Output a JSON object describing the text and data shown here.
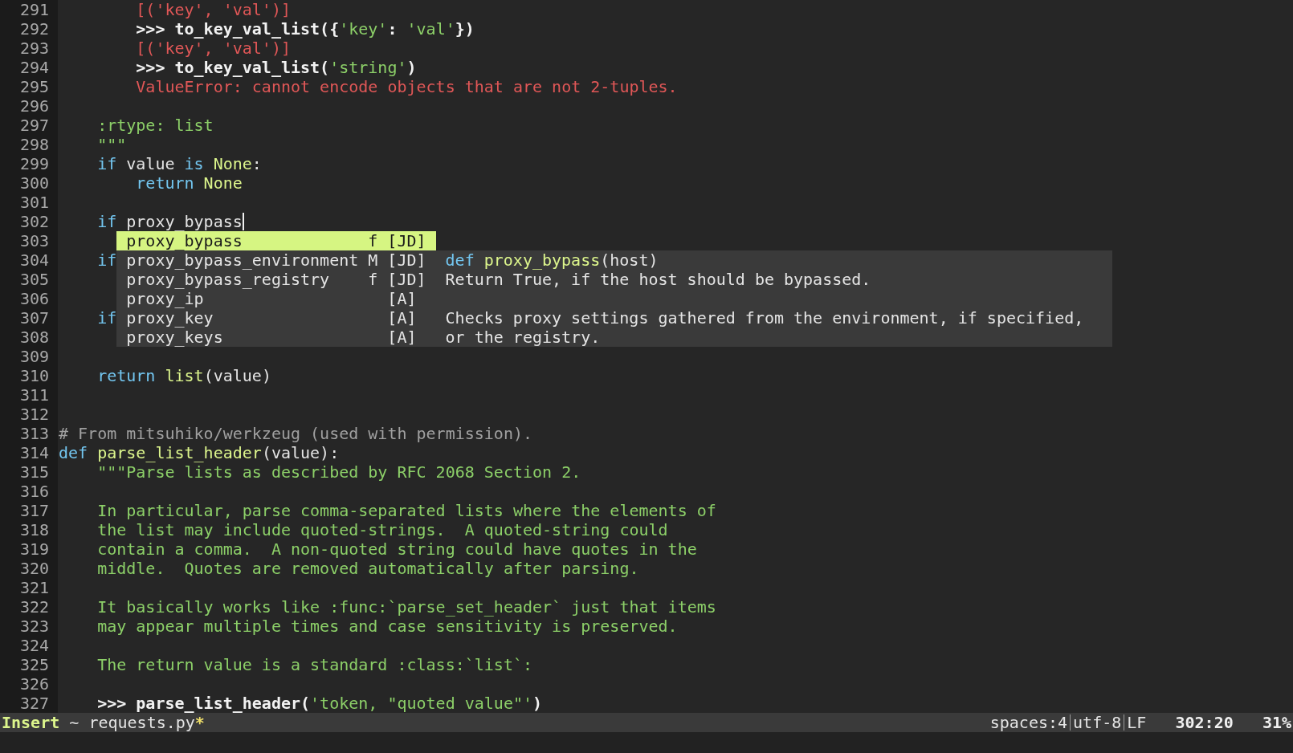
{
  "editor": {
    "lines": [
      {
        "number": "291",
        "cursor": false,
        "tokens": [
          {
            "t": "        [('key', 'val')]",
            "kind": "err"
          }
        ]
      },
      {
        "number": "292",
        "cursor": false,
        "tokens": [
          {
            "t": "        >>> to_key_val_list({",
            "kind": "bold"
          },
          {
            "t": "'key'",
            "kind": "str"
          },
          {
            "t": ": ",
            "kind": "bold"
          },
          {
            "t": "'val'",
            "kind": "str"
          },
          {
            "t": "})",
            "kind": "bold"
          }
        ]
      },
      {
        "number": "293",
        "cursor": false,
        "tokens": [
          {
            "t": "        [('key', 'val')]",
            "kind": "err"
          }
        ]
      },
      {
        "number": "294",
        "cursor": false,
        "tokens": [
          {
            "t": "        >>> to_key_val_list(",
            "kind": "bold"
          },
          {
            "t": "'string'",
            "kind": "str"
          },
          {
            "t": ")",
            "kind": "bold"
          }
        ]
      },
      {
        "number": "295",
        "cursor": false,
        "tokens": [
          {
            "t": "        ValueError: cannot encode objects that are not 2-tuples.",
            "kind": "err"
          }
        ]
      },
      {
        "number": "296",
        "cursor": false
      },
      {
        "number": "297",
        "cursor": false,
        "tokens": [
          {
            "t": "    :rtype: list",
            "kind": "doc"
          }
        ]
      },
      {
        "number": "298",
        "cursor": false,
        "tokens": [
          {
            "t": "    \"\"\"",
            "kind": "doc"
          }
        ]
      },
      {
        "number": "299",
        "cursor": false,
        "tokens": [
          {
            "t": "    if",
            "kind": "kw"
          },
          {
            "t": " value ",
            "kind": "plain"
          },
          {
            "t": "is",
            "kind": "kw"
          },
          {
            "t": " None",
            "kind": "const"
          },
          {
            "t": ":",
            "kind": "plain"
          }
        ]
      },
      {
        "number": "300",
        "cursor": false,
        "tokens": [
          {
            "t": "        return",
            "kind": "kw"
          },
          {
            "t": " None",
            "kind": "const"
          }
        ]
      },
      {
        "number": "301",
        "cursor": false
      },
      {
        "number": "302",
        "cursor": true,
        "tokens": [
          {
            "t": "    if",
            "kind": "kw"
          },
          {
            "t": " proxy_bypass",
            "kind": "plain"
          }
        ]
      },
      {
        "number": "303",
        "cursor": false
      },
      {
        "number": "304",
        "cursor": false,
        "tokens": [
          {
            "t": "    if",
            "kind": "kw"
          }
        ]
      },
      {
        "number": "305",
        "cursor": false
      },
      {
        "number": "306",
        "cursor": false
      },
      {
        "number": "307",
        "cursor": false,
        "tokens": [
          {
            "t": "    if",
            "kind": "kw"
          }
        ]
      },
      {
        "number": "308",
        "cursor": false
      },
      {
        "number": "309",
        "cursor": false
      },
      {
        "number": "310",
        "cursor": false,
        "tokens": [
          {
            "t": "    return",
            "kind": "kw"
          },
          {
            "t": " list",
            "kind": "const"
          },
          {
            "t": "(value)",
            "kind": "plain"
          }
        ]
      },
      {
        "number": "311",
        "cursor": false
      },
      {
        "number": "312",
        "cursor": false
      },
      {
        "number": "313",
        "cursor": false,
        "tokens": [
          {
            "t": "# From mitsuhiko/werkzeug (used with permission).",
            "kind": "comment"
          }
        ]
      },
      {
        "number": "314",
        "cursor": false,
        "tokens": [
          {
            "t": "def ",
            "kind": "kw"
          },
          {
            "t": "parse_list_header",
            "kind": "const"
          },
          {
            "t": "(value):",
            "kind": "plain"
          }
        ]
      },
      {
        "number": "315",
        "cursor": false,
        "tokens": [
          {
            "t": "    \"\"\"Parse lists as described by RFC 2068 Section 2.",
            "kind": "doc"
          }
        ]
      },
      {
        "number": "316",
        "cursor": false
      },
      {
        "number": "317",
        "cursor": false,
        "tokens": [
          {
            "t": "    In particular, parse comma-separated lists where the elements of",
            "kind": "doc"
          }
        ]
      },
      {
        "number": "318",
        "cursor": false,
        "tokens": [
          {
            "t": "    the list may include quoted-strings.  A quoted-string could",
            "kind": "doc"
          }
        ]
      },
      {
        "number": "319",
        "cursor": false,
        "tokens": [
          {
            "t": "    contain a comma.  A non-quoted string could have quotes in the",
            "kind": "doc"
          }
        ]
      },
      {
        "number": "320",
        "cursor": false,
        "tokens": [
          {
            "t": "    middle.  Quotes are removed automatically after parsing.",
            "kind": "doc"
          }
        ]
      },
      {
        "number": "321",
        "cursor": false
      },
      {
        "number": "322",
        "cursor": false,
        "tokens": [
          {
            "t": "    It basically works like :func:`parse_set_header` just that items",
            "kind": "doc"
          }
        ]
      },
      {
        "number": "323",
        "cursor": false,
        "tokens": [
          {
            "t": "    may appear multiple times and case sensitivity is preserved.",
            "kind": "doc"
          }
        ]
      },
      {
        "number": "324",
        "cursor": false
      },
      {
        "number": "325",
        "cursor": false,
        "tokens": [
          {
            "t": "    The return value is a standard :class:`list`:",
            "kind": "doc"
          }
        ]
      },
      {
        "number": "326",
        "cursor": false
      },
      {
        "number": "327",
        "cursor": false,
        "tokens": [
          {
            "t": "    >>> parse_list_header(",
            "kind": "bold"
          },
          {
            "t": "'token, \"quoted value\"'",
            "kind": "str"
          },
          {
            "t": ")",
            "kind": "bold"
          }
        ]
      }
    ]
  },
  "completion": {
    "items": [
      {
        "label": "proxy_bypass",
        "type": "f",
        "source": "[JD]",
        "selected": true
      },
      {
        "label": "proxy_bypass_environment",
        "type": "M",
        "source": "[JD]",
        "selected": false
      },
      {
        "label": "proxy_bypass_registry",
        "type": "f",
        "source": "[JD]",
        "selected": false
      },
      {
        "label": "proxy_ip",
        "source": "[A]",
        "selected": false
      },
      {
        "label": "proxy_key",
        "source": "[A]",
        "selected": false
      },
      {
        "label": "proxy_keys",
        "source": "[A]",
        "selected": false
      }
    ],
    "doc_paragraphs": [
      {
        "lines": [
          {
            "tokens": [
              {
                "t": "def ",
                "kind": "kw"
              },
              {
                "t": "proxy_bypass",
                "kind": "const"
              },
              {
                "t": "(host)",
                "kind": "plain"
              }
            ]
          },
          {
            "tokens": [
              {
                "t": "Return True, if the host should be bypassed.",
                "kind": "plain"
              }
            ]
          }
        ]
      },
      {
        "lines": [
          {
            "tokens": [
              {
                "t": "Checks proxy settings gathered from the environment, if specified,",
                "kind": "plain"
              }
            ]
          },
          {
            "tokens": [
              {
                "t": "or the registry.",
                "kind": "plain"
              }
            ]
          }
        ]
      }
    ]
  },
  "status_bar": {
    "mode": "Insert",
    "path_prefix": "~",
    "file": "requests.py",
    "modified_mark": "*",
    "indent": "spaces:4",
    "encoding": "utf-8",
    "line_ending": "LF",
    "position": "302:20",
    "scroll": "31%"
  }
}
